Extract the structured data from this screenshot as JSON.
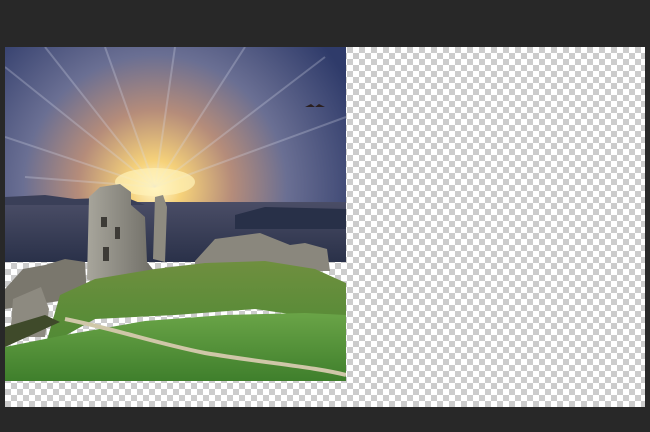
{
  "app": {
    "view": "image-editor-canvas"
  },
  "canvas": {
    "background": "transparent-checkerboard",
    "checker_colors": [
      "#ffffff",
      "#cccccc"
    ]
  },
  "photo_layer": {
    "subject": "castle-ruins-at-sunset",
    "colors": {
      "sky_top": "#3a4a78",
      "sky_glow": "#f6d27a",
      "sea": "#2b3550",
      "grass": "#5f9a3c",
      "stone": "#8c8a80"
    }
  }
}
